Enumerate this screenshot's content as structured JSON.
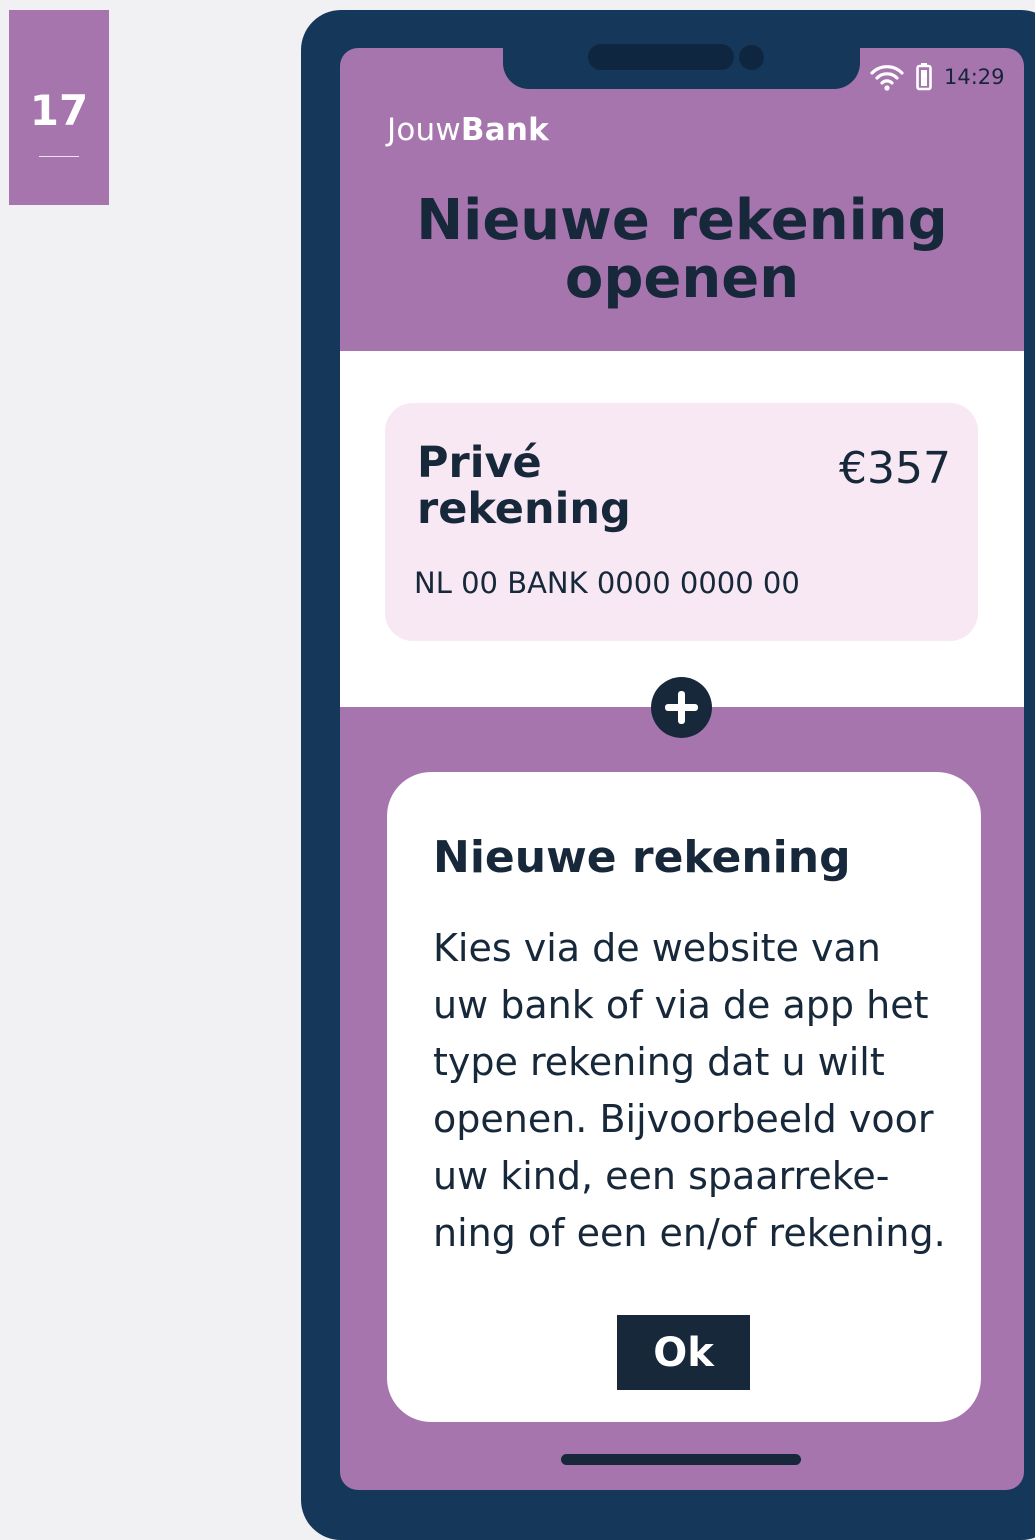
{
  "page_number": "17",
  "status_bar": {
    "time": "14:29",
    "icons": [
      "wifi-icon",
      "battery-icon"
    ]
  },
  "brand": {
    "prefix": "Jouw",
    "suffix": "Bank"
  },
  "title": "Nieuwe rekening openen",
  "account": {
    "name": "Privé rekening",
    "balance": "€357",
    "iban": "NL 00 BANK 0000 0000 00"
  },
  "add_icon": "plus-icon",
  "dialog": {
    "title": "Nieuwe rekening",
    "body": "Kies via de website van\nuw bank of via de app het\ntype rekening dat u wilt\nopenen. Bijvoorbeeld voor\nuw kind, een spaarreke-\nning of een en/of rekening.",
    "ok_label": "Ok"
  },
  "colors": {
    "accent_purple": "#a675ae",
    "phone_frame": "#15375a",
    "text_dark": "#16283a",
    "card_background": "#f7e8f3"
  }
}
